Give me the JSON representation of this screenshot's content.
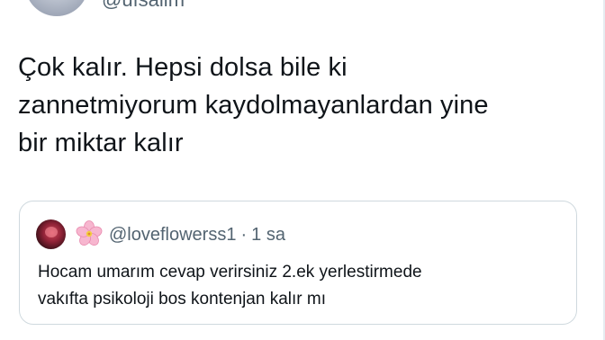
{
  "author": {
    "handle": "@ufsalim"
  },
  "tweet": {
    "text": "Çok kalır. Hepsi dolsa bile ki\nzannetmiyorum kaydolmayanlardan yine\nbir miktar kalır"
  },
  "quoted_tweet": {
    "handle": "@loveflowerss1",
    "separator": "·",
    "time": "1 sa",
    "text": "Hocam umarım cevap verirsiniz 2.ek yerlestirmede\nvakıfta psikoloji bos kontenjan kalır mı"
  },
  "icons": {
    "author_avatar": "avatar",
    "quoted_avatar": "avatar",
    "name_emoji": "cherry-blossom-icon"
  },
  "colors": {
    "text": "#0f1419",
    "secondary_text": "#536471",
    "card_border": "#cfd9de",
    "background": "#ffffff"
  }
}
